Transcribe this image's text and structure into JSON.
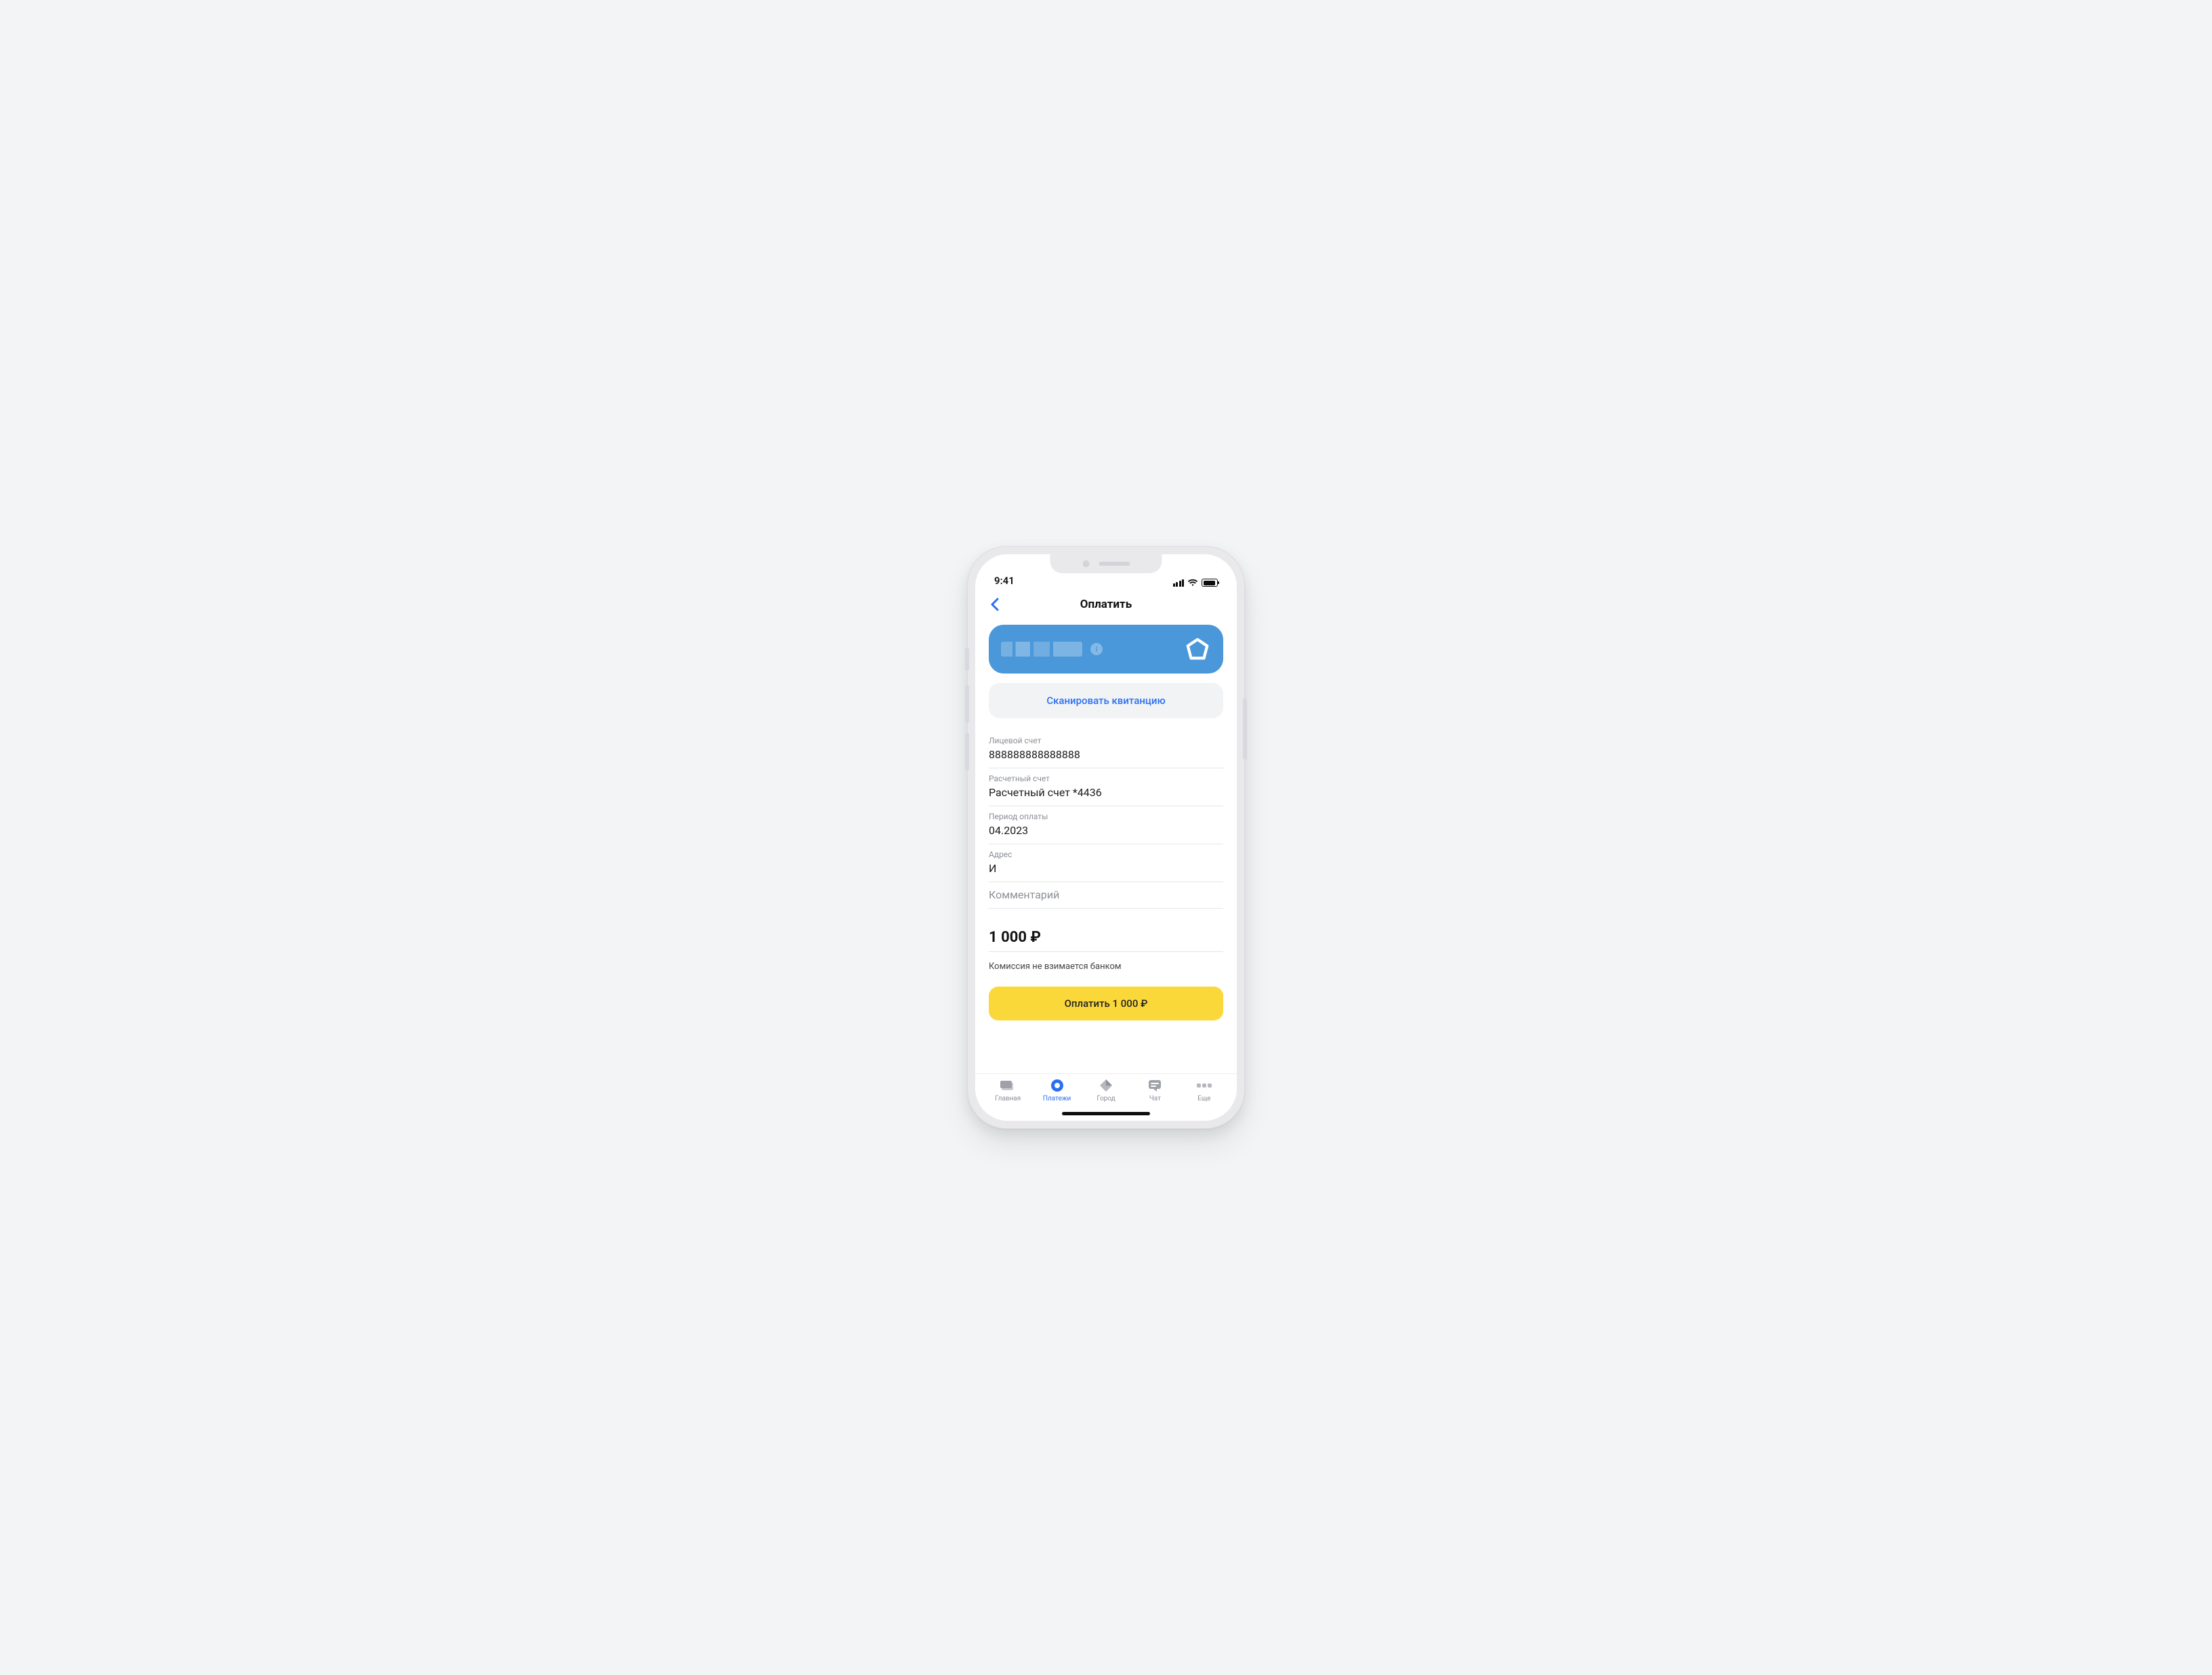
{
  "status": {
    "time": "9:41"
  },
  "nav": {
    "title": "Оплатить"
  },
  "scan_button": {
    "label": "Сканировать квитанцию"
  },
  "fields": {
    "account": {
      "label": "Лицевой счет",
      "value": "888888888888888"
    },
    "settlement": {
      "label": "Расчетный счет",
      "value": "Расчетный счет *4436"
    },
    "period": {
      "label": "Период оплаты",
      "value": "04.2023"
    },
    "address": {
      "label": "Адрес",
      "value": "И"
    },
    "comment": {
      "placeholder": "Комментарий"
    }
  },
  "amount": {
    "display": "1 000 ₽"
  },
  "fee_note": "Комиссия не взимается банком",
  "pay_button": {
    "label": "Оплатить 1 000 ₽"
  },
  "tabs": {
    "home": "Главная",
    "payments": "Платежи",
    "city": "Город",
    "chat": "Чат",
    "more": "Еще"
  },
  "colors": {
    "accent_blue": "#2a6ff3",
    "card_blue": "#4a97d9",
    "yellow": "#fbd83a"
  }
}
